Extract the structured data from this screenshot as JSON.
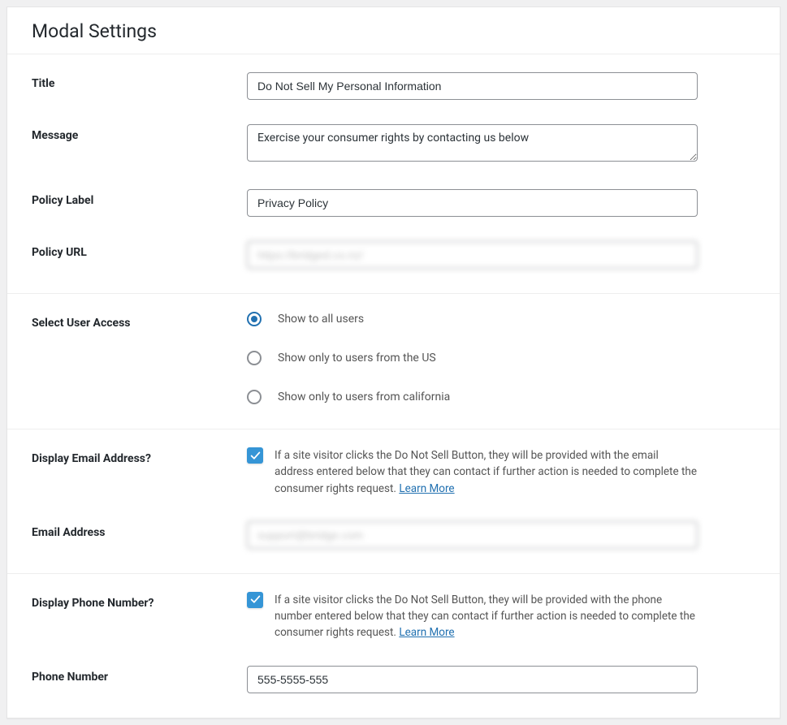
{
  "header": {
    "title": "Modal Settings"
  },
  "fields": {
    "title": {
      "label": "Title",
      "value": "Do Not Sell My Personal Information"
    },
    "message": {
      "label": "Message",
      "value": "Exercise your consumer rights by contacting us below"
    },
    "policy_label": {
      "label": "Policy Label",
      "value": "Privacy Policy"
    },
    "policy_url": {
      "label": "Policy URL",
      "value": "https://bridged.co.nz/"
    },
    "user_access": {
      "label": "Select User Access",
      "selected": 0,
      "options": [
        "Show to all users",
        "Show only to users from the US",
        "Show only to users from california"
      ]
    },
    "display_email": {
      "label": "Display Email Address?",
      "checked": true,
      "description": "If a site visitor clicks the Do Not Sell Button, they will be provided with the email address entered below that they can contact if further action is needed to complete the consumer rights request. ",
      "learn_more": "Learn More"
    },
    "email_address": {
      "label": "Email Address",
      "value": "support@bridge.com"
    },
    "display_phone": {
      "label": "Display Phone Number?",
      "checked": true,
      "description": "If a site visitor clicks the Do Not Sell Button, they will be provided with the phone number entered below that they can contact if further action is needed to complete the consumer rights request. ",
      "learn_more": "Learn More"
    },
    "phone_number": {
      "label": "Phone Number",
      "value": "555-5555-555"
    }
  }
}
